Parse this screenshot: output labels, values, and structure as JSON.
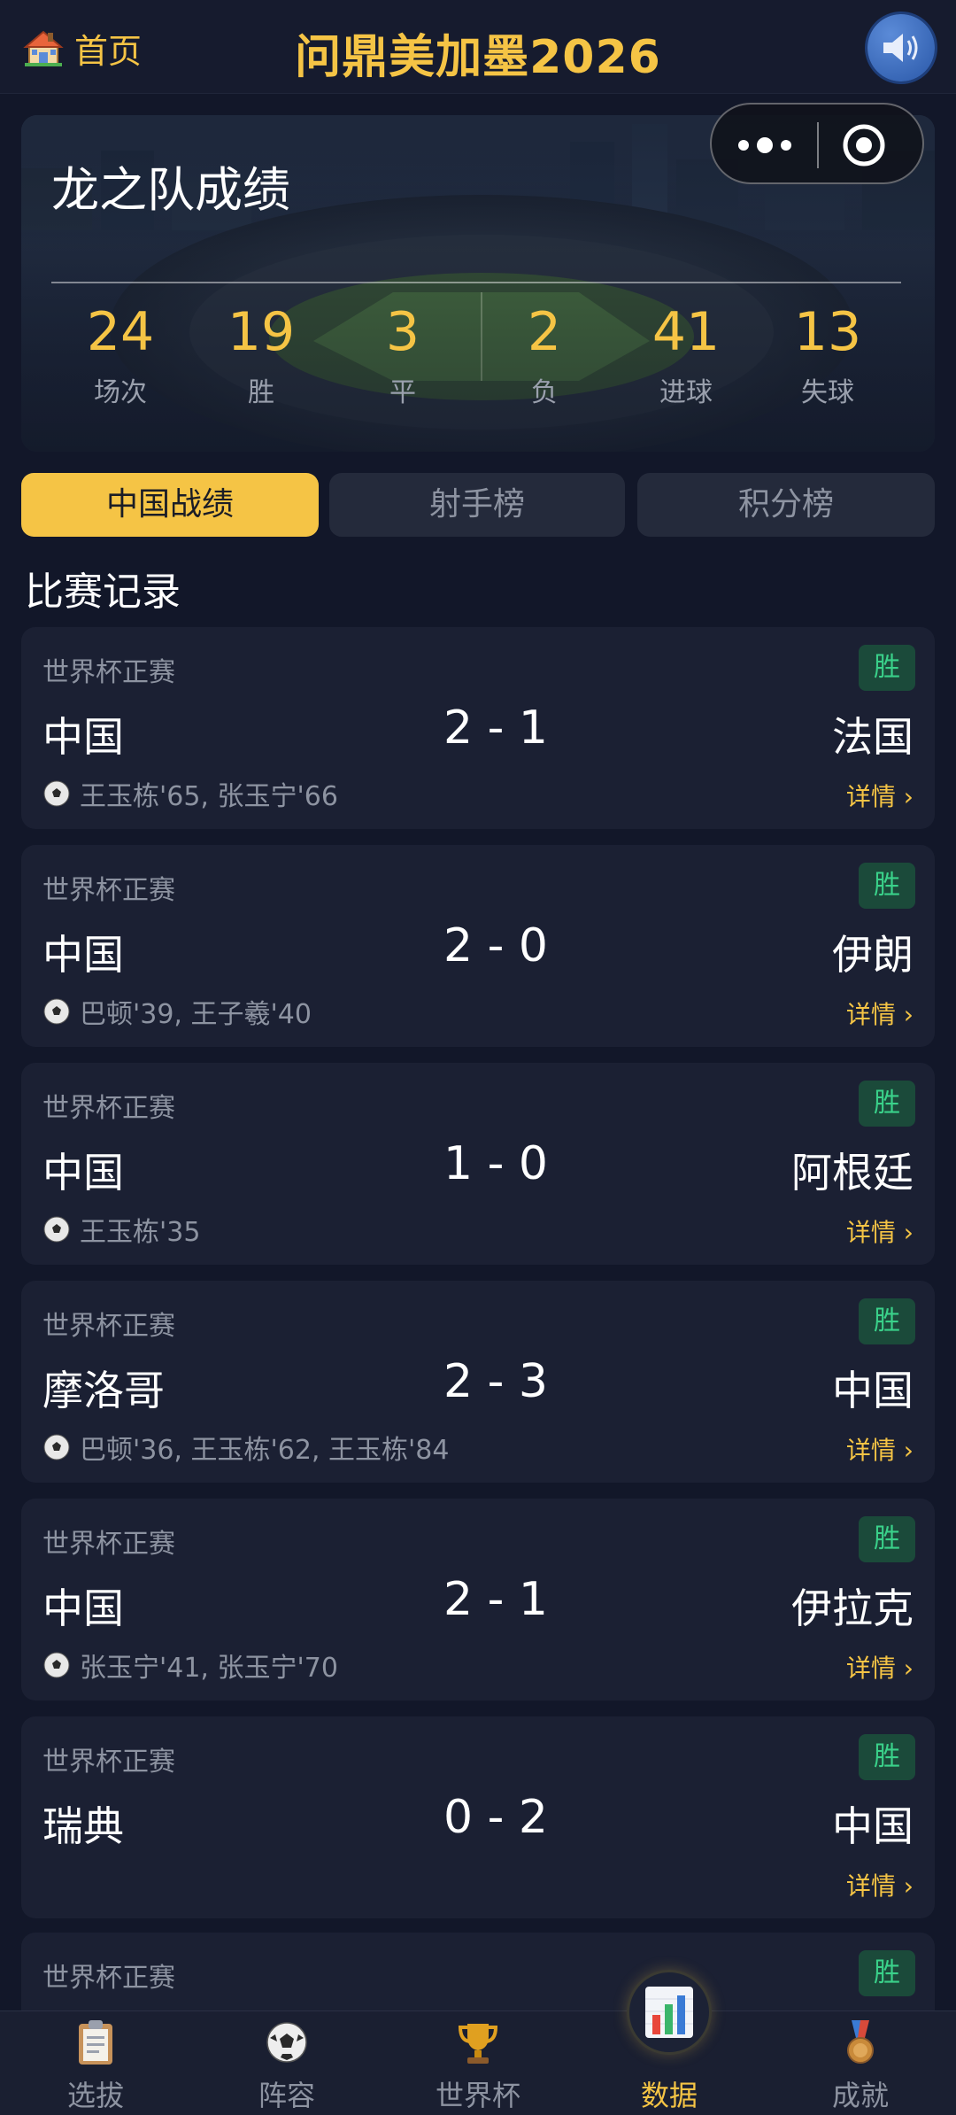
{
  "header": {
    "home_label": "首页",
    "title": "问鼎美加墨2026",
    "home_icon": "house-icon",
    "sound_icon": "speaker-icon"
  },
  "hero": {
    "title": "龙之队成绩",
    "stats": [
      {
        "value": "24",
        "label": "场次"
      },
      {
        "value": "19",
        "label": "胜"
      },
      {
        "value": "3",
        "label": "平"
      },
      {
        "value": "2",
        "label": "负"
      },
      {
        "value": "41",
        "label": "进球"
      },
      {
        "value": "13",
        "label": "失球"
      }
    ]
  },
  "tabs": [
    {
      "label": "中国战绩",
      "active": true
    },
    {
      "label": "射手榜",
      "active": false
    },
    {
      "label": "积分榜",
      "active": false
    }
  ],
  "section_title": "比赛记录",
  "matches": [
    {
      "competition": "世界杯正赛",
      "result": "胜",
      "home": "中国",
      "score": "2 - 1",
      "away": "法国",
      "scorers": "王玉栋'65, 张玉宁'66",
      "details": "详情 ›"
    },
    {
      "competition": "世界杯正赛",
      "result": "胜",
      "home": "中国",
      "score": "2 - 0",
      "away": "伊朗",
      "scorers": "巴顿'39, 王子羲'40",
      "details": "详情 ›"
    },
    {
      "competition": "世界杯正赛",
      "result": "胜",
      "home": "中国",
      "score": "1 - 0",
      "away": "阿根廷",
      "scorers": "王玉栋'35",
      "details": "详情 ›"
    },
    {
      "competition": "世界杯正赛",
      "result": "胜",
      "home": "摩洛哥",
      "score": "2 - 3",
      "away": "中国",
      "scorers": "巴顿'36, 王玉栋'62, 王玉栋'84",
      "details": "详情 ›"
    },
    {
      "competition": "世界杯正赛",
      "result": "胜",
      "home": "中国",
      "score": "2 - 1",
      "away": "伊拉克",
      "scorers": "张玉宁'41, 张玉宁'70",
      "details": "详情 ›"
    },
    {
      "competition": "世界杯正赛",
      "result": "胜",
      "home": "瑞典",
      "score": "0 - 2",
      "away": "中国",
      "scorers": "",
      "details": "详情 ›"
    },
    {
      "competition": "世界杯正赛",
      "result": "胜",
      "home": "",
      "score": "",
      "away": "",
      "scorers": "",
      "details": ""
    }
  ],
  "bottom_nav": [
    {
      "label": "选拔",
      "icon": "clipboard-icon",
      "active": false
    },
    {
      "label": "阵容",
      "icon": "soccer-ball-icon",
      "active": false
    },
    {
      "label": "世界杯",
      "icon": "trophy-icon",
      "active": false
    },
    {
      "label": "数据",
      "icon": "bar-chart-icon",
      "active": true
    },
    {
      "label": "成就",
      "icon": "medal-icon",
      "active": false
    }
  ],
  "colors": {
    "accent": "#f5c445",
    "background": "#121729",
    "card": "#1b2033",
    "win_badge_bg": "#1b4a3a",
    "win_badge_text": "#3ad18a"
  }
}
